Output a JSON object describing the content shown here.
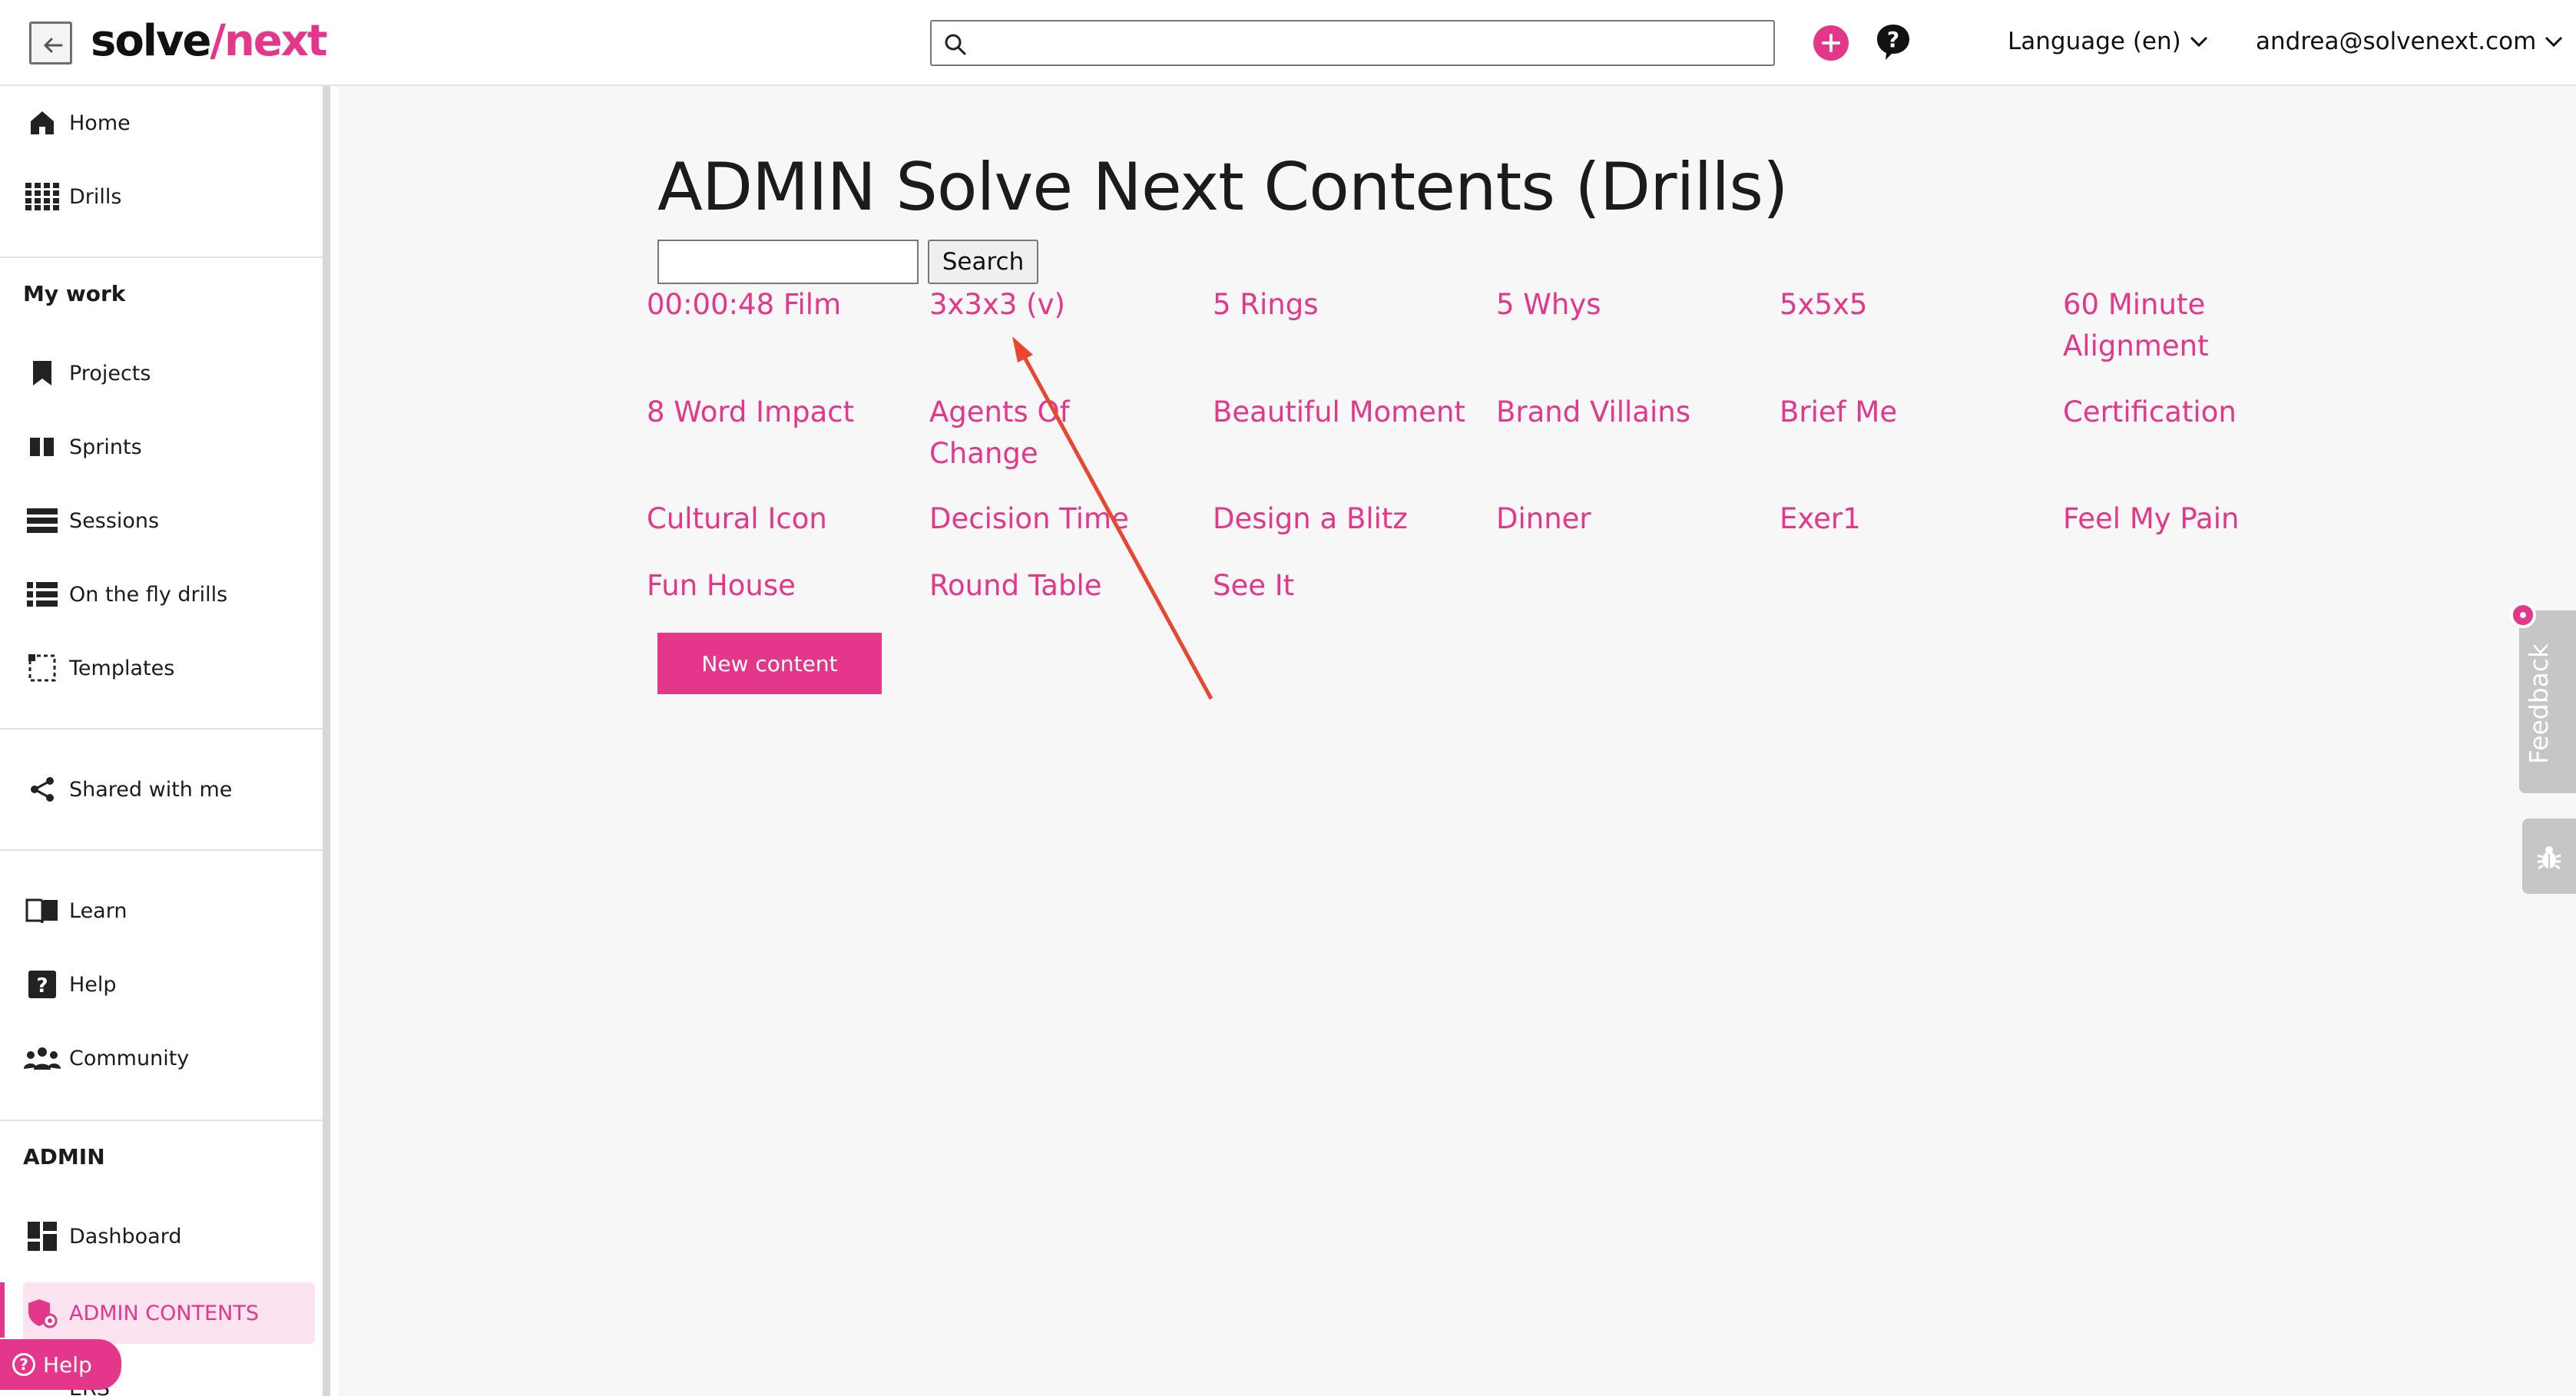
{
  "topbar": {
    "logo_part1": "solve",
    "logo_slash": "/",
    "logo_part2": "next",
    "search_placeholder": "",
    "language_label": "Language (en)",
    "user_email": "andrea@solvenext.com"
  },
  "sidebar": {
    "home": "Home",
    "drills": "Drills",
    "my_work_title": "My work",
    "projects": "Projects",
    "sprints": "Sprints",
    "sessions": "Sessions",
    "on_the_fly": "On the fly drills",
    "templates": "Templates",
    "shared": "Shared with me",
    "learn": "Learn",
    "help": "Help",
    "community": "Community",
    "admin_title": "ADMIN",
    "dashboard": "Dashboard",
    "admin_contents": "ADMIN CONTENTS",
    "users_partial": "ERS",
    "help_pill": "Help"
  },
  "main": {
    "title": "ADMIN Solve Next Contents (Drills)",
    "search_value": "",
    "search_button": "Search",
    "drills": [
      [
        "00:00:48 Film",
        "3x3x3 (v)",
        "5 Rings",
        "5 Whys",
        "5x5x5",
        "60 Minute Alignment"
      ],
      [
        "8 Word Impact",
        "Agents Of Change",
        "Beautiful Moment",
        "Brand Villains",
        "Brief Me",
        "Certification"
      ],
      [
        "Cultural Icon",
        "Decision Time",
        "Design a Blitz",
        "Dinner",
        "Exer1",
        "Feel My Pain"
      ],
      [
        "Fun House",
        "Round Table",
        "See It"
      ]
    ],
    "new_content_button": "New content"
  },
  "widgets": {
    "feedback_label": "Feedback"
  },
  "colors": {
    "accent": "#e4368b",
    "annotation_arrow": "#e8462f"
  }
}
